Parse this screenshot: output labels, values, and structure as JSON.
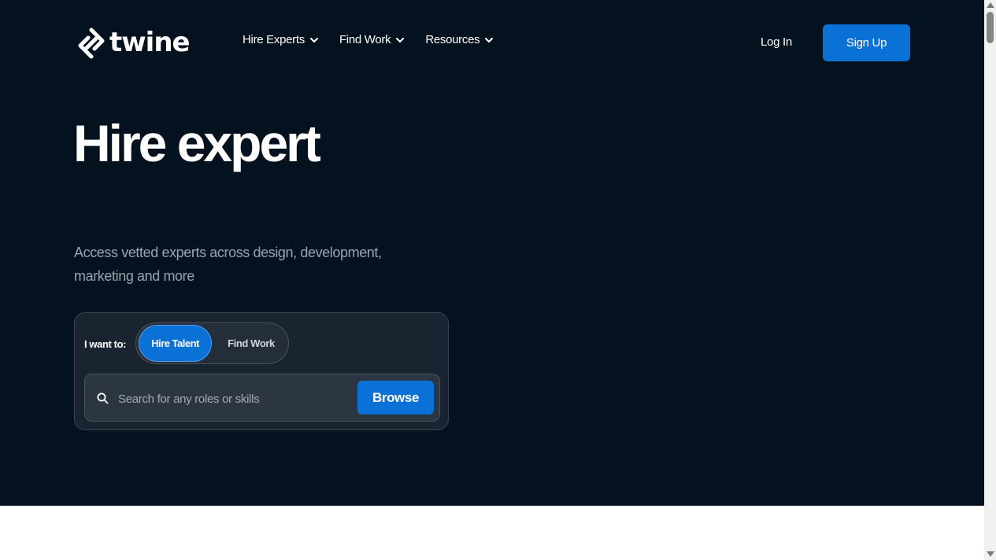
{
  "brand": {
    "name": "twine",
    "logo_icon": "twine-logo-icon"
  },
  "nav": {
    "items": [
      {
        "label": "Hire Experts",
        "icon": "chevron-down-icon"
      },
      {
        "label": "Find Work",
        "icon": "chevron-down-icon"
      },
      {
        "label": "Resources",
        "icon": "chevron-down-icon"
      }
    ],
    "login_label": "Log In",
    "signup_label": "Sign Up"
  },
  "hero": {
    "headline": "Hire expert",
    "subtitle": "Access vetted experts across design, development, marketing and more"
  },
  "search_card": {
    "want_label": "I want to:",
    "toggle": {
      "options": [
        "Hire Talent",
        "Find Work"
      ],
      "selected": "Hire Talent"
    },
    "search": {
      "placeholder": "Search for any roles or skills",
      "value": "",
      "icon": "search-icon"
    },
    "browse_label": "Browse"
  },
  "colors": {
    "hero_background": "#04111f",
    "accent": "#0a72d6",
    "subtitle_text": "#9aa3ad",
    "card_background": "#1a2430",
    "below_fold_background": "#ffffff"
  }
}
